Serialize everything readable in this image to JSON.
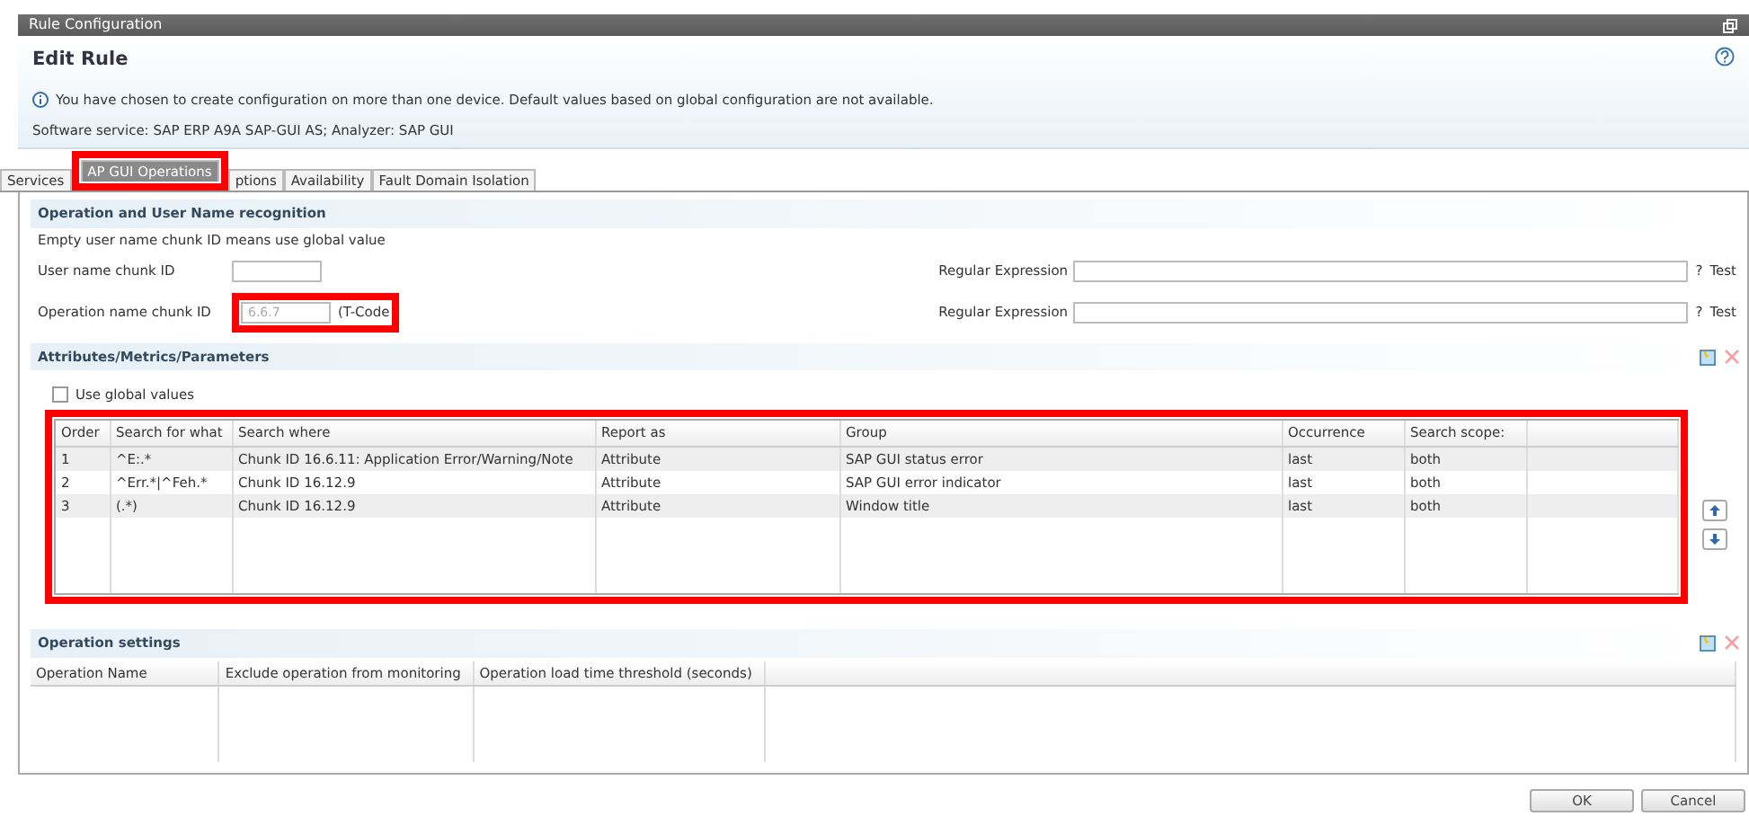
{
  "window": {
    "title": "Rule Configuration"
  },
  "header": {
    "title": "Edit Rule",
    "info": "You have chosen to create configuration on more than one device. Default values based on global configuration are not available.",
    "software_service": "Software service: SAP ERP A9A SAP-GUI AS; Analyzer: SAP GUI"
  },
  "tabs": [
    {
      "label": "Services",
      "selected": false,
      "highlighted": false
    },
    {
      "label": "AP GUI Operations",
      "selected": true,
      "highlighted": true
    },
    {
      "label": "ptions",
      "selected": false,
      "highlighted": false
    },
    {
      "label": "Availability",
      "selected": false,
      "highlighted": false
    },
    {
      "label": "Fault Domain Isolation",
      "selected": false,
      "highlighted": false
    }
  ],
  "recognition": {
    "title": "Operation and User Name recognition",
    "hint": "Empty user name chunk ID means use global value",
    "fields": [
      {
        "label": "User name chunk ID",
        "highlighted": false,
        "regex_label": "Regular Expression",
        "help": "?",
        "test": "Test"
      },
      {
        "label": "Operation name chunk ID",
        "value": "6.6.7",
        "suffix": "(T-Code",
        "highlighted": true,
        "regex_label": "Regular Expression",
        "help": "?",
        "test": "Test"
      }
    ]
  },
  "attributes": {
    "title": "Attributes/Metrics/Parameters",
    "use_global": {
      "label": "Use global values",
      "checked": false
    },
    "table": {
      "highlighted": true,
      "columns": [
        "Order",
        "Search for what",
        "Search where",
        "Report as",
        "Group",
        "Occurrence",
        "Search scope:"
      ],
      "rows": [
        [
          "1",
          "^E:.*",
          "Chunk ID 16.6.11: Application Error/Warning/Note",
          "Attribute",
          "SAP GUI status error",
          "last",
          "both"
        ],
        [
          "2",
          "^Err.*|^Feh.*",
          "Chunk ID 16.12.9",
          "Attribute",
          "SAP GUI error indicator",
          "last",
          "both"
        ],
        [
          "3",
          "(.*)",
          "Chunk ID 16.12.9",
          "Attribute",
          "Window title",
          "last",
          "both"
        ]
      ]
    }
  },
  "operation_settings": {
    "title": "Operation settings",
    "columns": [
      "Operation Name",
      "Exclude operation from monitoring",
      "Operation load time threshold (seconds)"
    ]
  },
  "buttons": [
    "OK",
    "Cancel"
  ]
}
